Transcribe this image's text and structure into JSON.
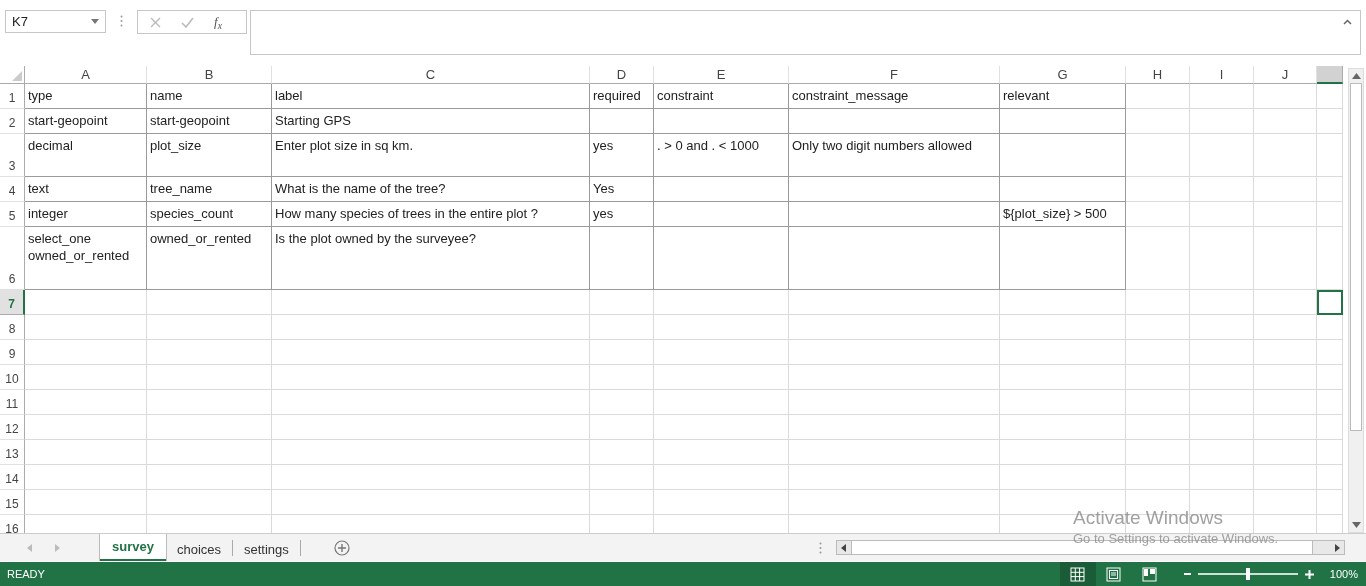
{
  "name_box": {
    "value": "K7"
  },
  "formula_bar": {
    "function_label": "f$_{x}$"
  },
  "columns": [
    {
      "label": "A",
      "selected": false
    },
    {
      "label": "B",
      "selected": false
    },
    {
      "label": "C",
      "selected": false
    },
    {
      "label": "D",
      "selected": false
    },
    {
      "label": "E",
      "selected": false
    },
    {
      "label": "F",
      "selected": false
    },
    {
      "label": "G",
      "selected": false
    },
    {
      "label": "H",
      "selected": false
    },
    {
      "label": "I",
      "selected": false
    },
    {
      "label": "J",
      "selected": false
    },
    {
      "selected": true
    }
  ],
  "rows": [
    {
      "number": "1",
      "selected": false,
      "cells": {
        "A": "type",
        "B": "name",
        "C": "label",
        "D": "required",
        "E": "constraint",
        "F": "constraint_message",
        "G": "relevant"
      }
    },
    {
      "number": "2",
      "selected": false,
      "cells": {
        "A": "start-geopoint",
        "B": "start-geopoint",
        "C": "Starting GPS"
      }
    },
    {
      "number": "3",
      "selected": false,
      "cells": {
        "A": "decimal",
        "B": "plot_size",
        "C": "Enter plot size in sq km.",
        "D": "yes",
        "E": ". > 0 and . < 1000",
        "F": "Only two digit numbers allowed"
      }
    },
    {
      "number": "4",
      "selected": false,
      "cells": {
        "A": "text",
        "B": "tree_name",
        "C": "What is the name of the tree?",
        "D": "Yes"
      }
    },
    {
      "number": "5",
      "selected": false,
      "cells": {
        "A": "integer",
        "B": "species_count",
        "C": "How many species of trees in the entire plot ?",
        "D": "yes",
        "G": "${plot_size} > 500"
      }
    },
    {
      "number": "6",
      "selected": false,
      "cells": {
        "A": "select_one owned_or_rented",
        "B": "owned_or_rented",
        "C": "Is the plot owned by the surveyee?"
      }
    },
    {
      "number": "7",
      "selected": true
    },
    {
      "number": "8",
      "selected": false
    },
    {
      "number": "9",
      "selected": false
    },
    {
      "number": "10",
      "selected": false
    },
    {
      "number": "11",
      "selected": false
    },
    {
      "number": "12",
      "selected": false
    },
    {
      "number": "13",
      "selected": false
    },
    {
      "number": "14",
      "selected": false
    },
    {
      "number": "15",
      "selected": false
    },
    {
      "number": "16",
      "selected": false
    }
  ],
  "sheet_tabs": [
    {
      "label": "survey",
      "selected": true
    },
    {
      "label": "choices",
      "selected": false
    },
    {
      "label": "settings",
      "selected": false
    }
  ],
  "status_bar": {
    "mode": "READY",
    "views": [
      {
        "kind": "normal",
        "selected": true
      },
      {
        "kind": "page_layout",
        "selected": false
      },
      {
        "kind": "page_break",
        "selected": false
      }
    ],
    "zoom": {
      "level": 0.5,
      "reading": "100%"
    }
  },
  "os_overlay": {
    "title": "Activate Windows",
    "subtitle": "Go to Settings to activate Windows."
  }
}
